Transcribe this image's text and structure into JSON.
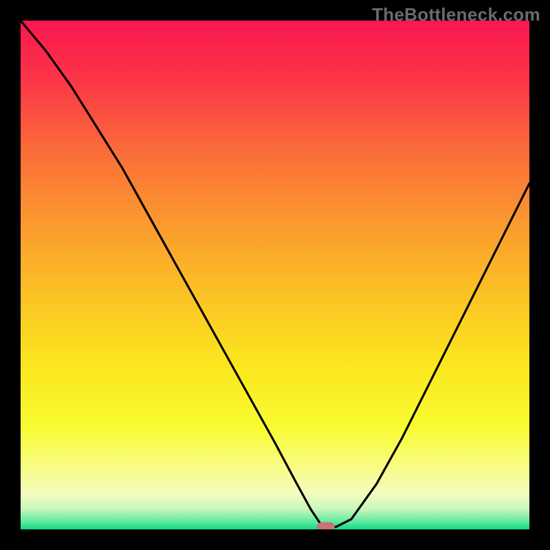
{
  "watermark": "TheBottleneck.com",
  "chart_data": {
    "type": "line",
    "title": "",
    "xlabel": "",
    "ylabel": "",
    "xlim": [
      0,
      100
    ],
    "ylim": [
      0,
      100
    ],
    "grid": false,
    "legend": false,
    "series": [
      {
        "name": "bottleneck-curve",
        "x": [
          0,
          5,
          10,
          15,
          20,
          25,
          30,
          35,
          40,
          45,
          50,
          54,
          57,
          59,
          60,
          62,
          65,
          70,
          75,
          80,
          85,
          90,
          95,
          100
        ],
        "y": [
          100,
          94,
          87,
          79,
          71,
          62,
          53,
          44,
          35,
          26,
          17,
          9.5,
          4,
          1,
          0.5,
          0.5,
          2,
          9,
          18,
          28,
          38,
          48,
          58,
          68
        ],
        "color": "#000000"
      }
    ],
    "background_gradient_stops": [
      {
        "offset": 0.0,
        "color": "#fa1651"
      },
      {
        "offset": 0.12,
        "color": "#fb3647"
      },
      {
        "offset": 0.25,
        "color": "#fb6a3a"
      },
      {
        "offset": 0.4,
        "color": "#fb9a2e"
      },
      {
        "offset": 0.55,
        "color": "#fbc524"
      },
      {
        "offset": 0.68,
        "color": "#fbe71e"
      },
      {
        "offset": 0.8,
        "color": "#f9fb32"
      },
      {
        "offset": 0.88,
        "color": "#f7fc86"
      },
      {
        "offset": 0.93,
        "color": "#f4fdc0"
      },
      {
        "offset": 0.96,
        "color": "#c8f8bc"
      },
      {
        "offset": 0.985,
        "color": "#5ee9a0"
      },
      {
        "offset": 1.0,
        "color": "#0fdc84"
      }
    ],
    "marker": {
      "x": 60,
      "y": 0.5,
      "width_frac": 0.035,
      "height_frac": 0.018,
      "color": "#c7736f"
    }
  }
}
